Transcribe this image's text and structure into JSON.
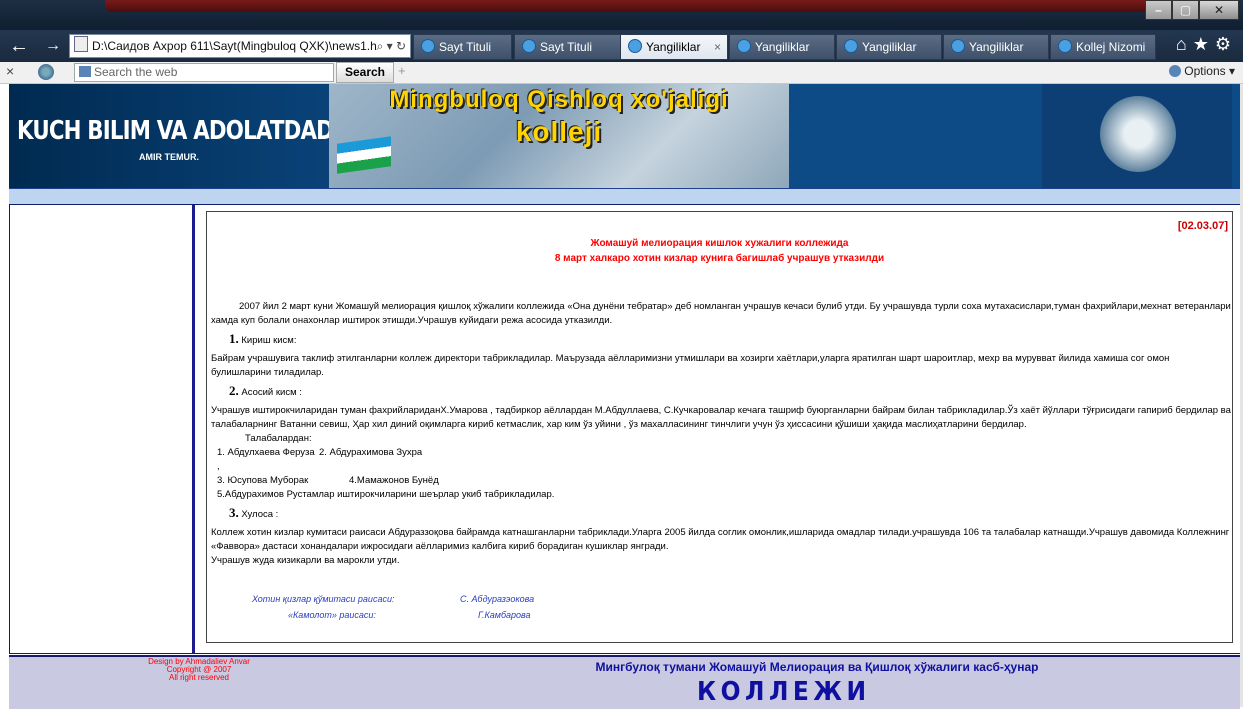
{
  "browser": {
    "address": "D:\\Саидов Ахрор 611\\Sayt(Mingbuloq QXK)\\news1.h",
    "address_tools": "⌕ ▾ ↻",
    "tabs": [
      {
        "label": "Sayt Tituli",
        "active": false
      },
      {
        "label": "Sayt Tituli",
        "active": false
      },
      {
        "label": "Yangiliklar",
        "active": true
      },
      {
        "label": "Yangiliklar",
        "active": false
      },
      {
        "label": "Yangiliklar",
        "active": false
      },
      {
        "label": "Yangiliklar",
        "active": false
      },
      {
        "label": "Kollej Nizomi",
        "active": false
      }
    ],
    "tab_close": "×"
  },
  "toolbar": {
    "search_placeholder": "Search the web",
    "search_button": "Search",
    "options_label": "Options"
  },
  "banner": {
    "motto": "KUCH BILIM VA ADOLATDADUR",
    "author": "AMIR TEMUR.",
    "college_line1": "Mingbuloq Qishloq xo'jaligi",
    "college_line2": "kolleji"
  },
  "article": {
    "date": "[02.03.07]",
    "headline_line1": "Жомашуй мелиорация кишлок хужалиги коллежида",
    "headline_line2": "8 март халкаро хотин кизлар  кунига багишлаб  учрашув утказилди",
    "intro": "2007 йил 2 март куни Жомашуй мелиорация қишлоқ хўжалиги коллежида «Она дунёни тебратар» деб номланган учрашув кечаси булиб утди. Бу учрашувда турли соха мутахасислари,туман фахрийлари,мехнат ветеранлари  хамда куп болали онахонлар иштирок этишди.Учрашув куйидаги режа асосида утказилди.",
    "s1_num": "1.",
    "s1_title": "Кириш кисм:",
    "s1_text": "Байрам учрашувига таклиф этилганларни коллеж директори табрикладилар. Маърузада аёлларимизни утмишлари ва хозирги хаётлари,уларга яратилган шарт шароитлар, мехр ва мурувват йилида хамиша сог омон булишларини тиладилар.",
    "s2_num": "2.",
    "s2_title": "Асосий кисм :",
    "s2_text": "Учрашув иштирокчиларидан  туман фахрийлариданХ.Умарова , тадбиркор аёллардан   М.Абдуллаева, С.Кучкаровалар кечага ташриф буюрганларни байрам билан табрикладилар.Ўз хаёт йўллари тўғрисидаги гапириб бердилар ва талабаларнинг Ватанни севиш, Ҳар хил диний оқимларга кириб кетмаслик, хар ким ўз уйини , ўз махалласининг тинчлиги учун ўз ҳиссасини қўшиши ҳақида маслиҳатларини бердилар.",
    "students_label": "Талабалардан:",
    "students": [
      [
        "1. Абдулхаева Феруза ,",
        "2.  Абдурахимова Зухра"
      ],
      [
        "3. Юсупова Муборак",
        "4.Мамажонов Бунёд"
      ]
    ],
    "students_last": "5.Абдурахимов Рустамлар иштирокчиларини шеърлар укиб табрикладилар.",
    "s3_num": "3.",
    "s3_title": "Хулоса :",
    "s3_text": "  Коллеж хотин кизлар кумитаси раисаси Абдураззоқова  байрамда катнашганларни табриклади.Уларга 2005 йилда соглик омонлик,ишларида омадлар тилади.учрашувда  106 та талабалар катнашди.Учрашув давомида Коллежнинг «Фаввора» дастаси хонандалари ижросидаги аёлларимиз калбига кириб боpадиган кушиклар янгради.",
    "closing": "Учрашув жуда кизикарли ва марокли утди.",
    "sig1_role": "Хотин қизлар қўмитаси раисаси:",
    "sig1_name": "С. Абдуразэокова",
    "sig2_role": "«Камолот» раисаси:",
    "sig2_name": "Г.Камбарова"
  },
  "footer": {
    "design_line1": "Design by Ahmadaliev Anvar",
    "design_line2": "Copyright @ 2007",
    "design_line3": "All right reserved",
    "college_full": "Мингбулоқ тумани Жомашуй Мелиорация ва Қишлоқ хўжалиги касб-ҳунар",
    "college_word": "КОЛЛЕЖИ"
  },
  "colors": {
    "accent_red": "#ff0000",
    "footer_blue": "#1010a0",
    "banner_blue": "#0d4b87"
  }
}
